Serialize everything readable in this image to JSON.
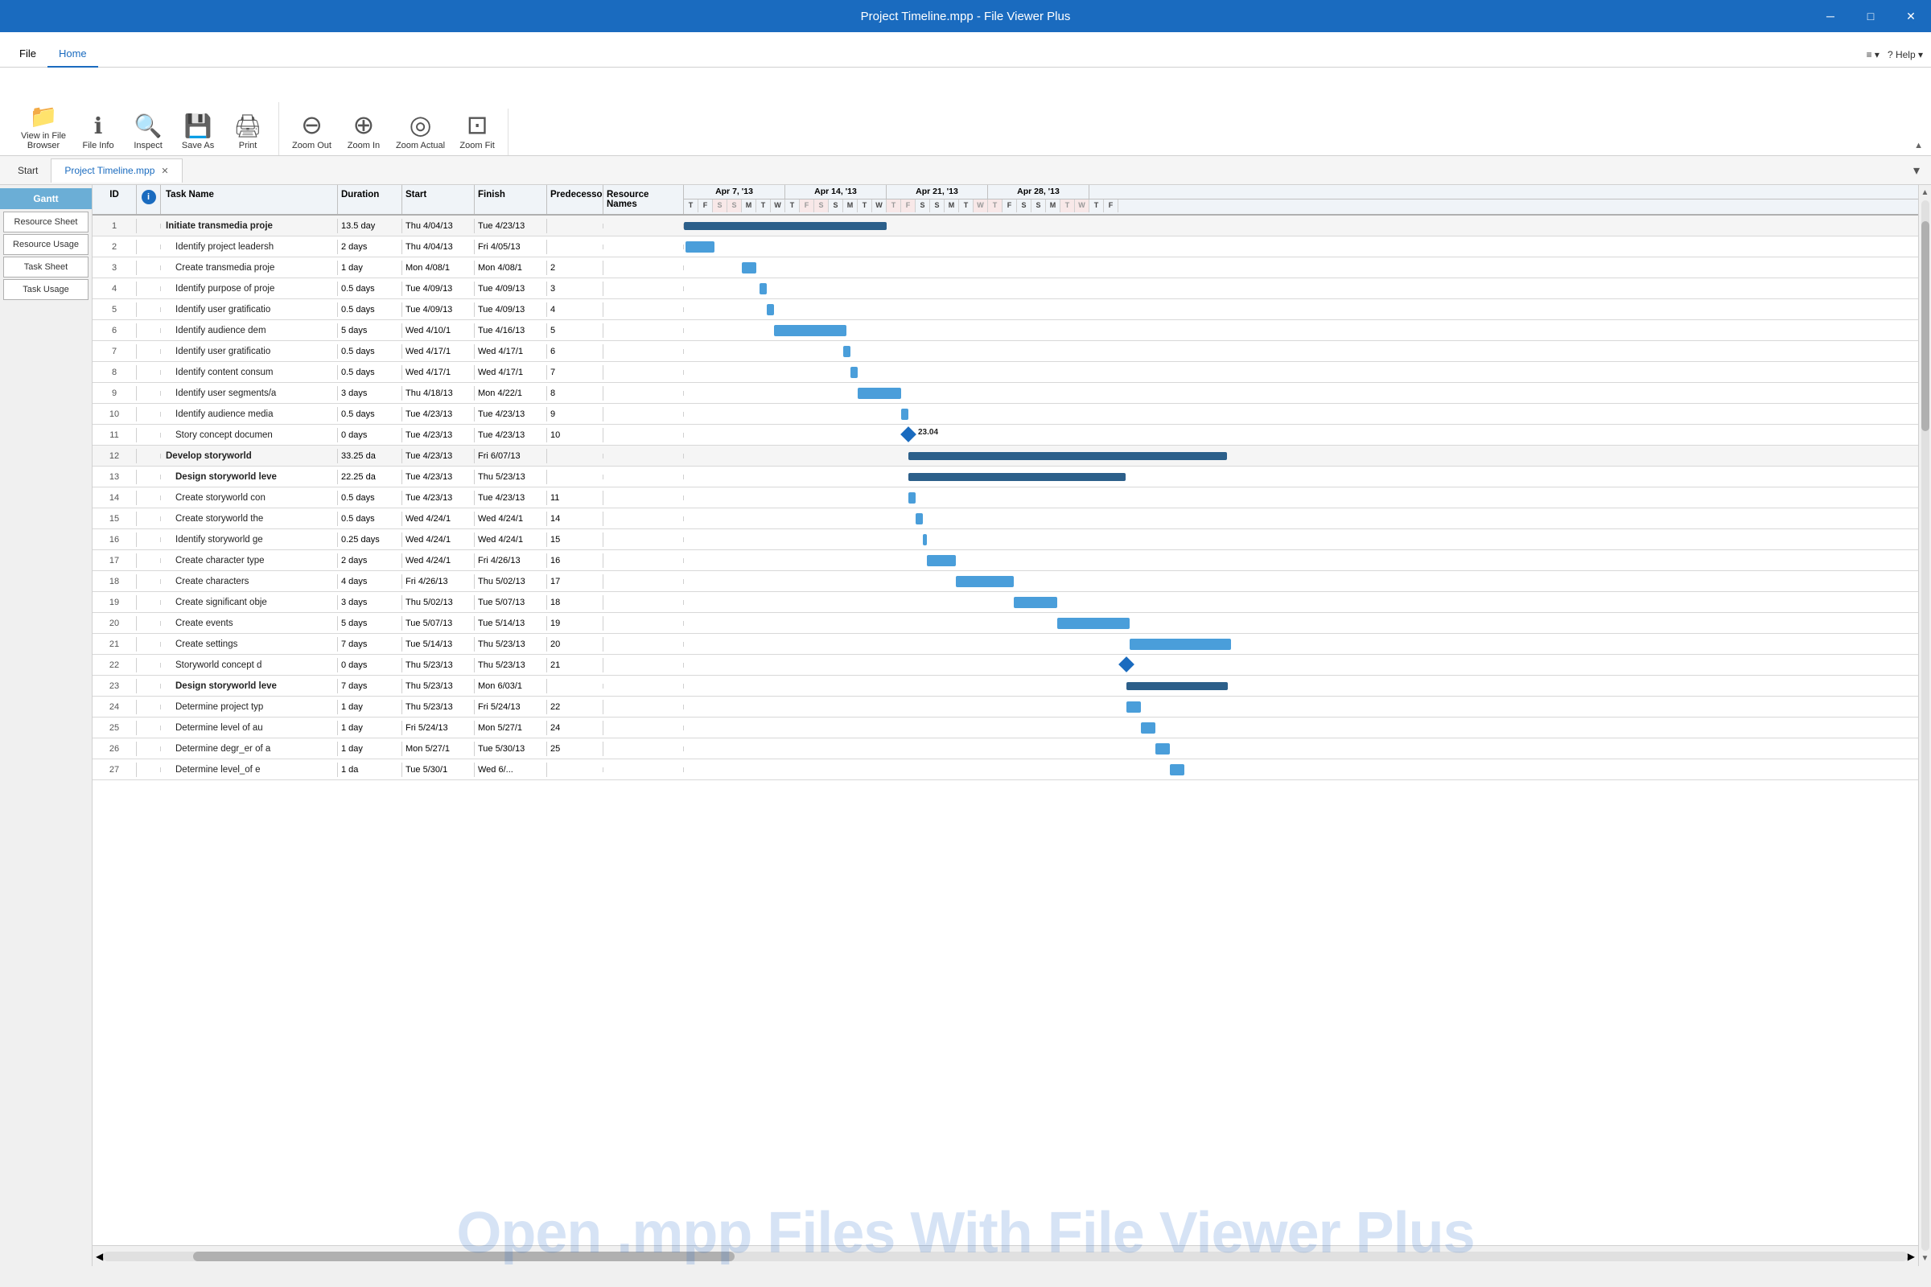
{
  "titleBar": {
    "title": "Project Timeline.mpp - File Viewer Plus",
    "minBtn": "─",
    "maxBtn": "□",
    "closeBtn": "✕"
  },
  "menuBar": {
    "items": [
      "File",
      "Home"
    ],
    "activeItem": "Home",
    "rightItems": [
      "≡ ▾",
      "? Help ▾"
    ]
  },
  "ribbon": {
    "buttons": [
      {
        "icon": "📁",
        "label": "View in File\nBrowser",
        "name": "view-in-file-browser"
      },
      {
        "icon": "ℹ",
        "label": "File Info",
        "name": "file-info"
      },
      {
        "icon": "🔍",
        "label": "Inspect",
        "name": "inspect"
      },
      {
        "icon": "💾",
        "label": "Save As",
        "name": "save-as"
      },
      {
        "icon": "🖨",
        "label": "Print",
        "name": "print"
      },
      {
        "icon": "⊖",
        "label": "Zoom Out",
        "name": "zoom-out"
      },
      {
        "icon": "⊕",
        "label": "Zoom In",
        "name": "zoom-in"
      },
      {
        "icon": "◎",
        "label": "Zoom Actual",
        "name": "zoom-actual"
      },
      {
        "icon": "⊡",
        "label": "Zoom Fit",
        "name": "zoom-fit"
      }
    ]
  },
  "tabs": {
    "startLabel": "Start",
    "fileTab": "Project Timeline.mpp",
    "closeBtn": "✕"
  },
  "sidebar": {
    "ganttLabel": "Gantt",
    "buttons": [
      {
        "label": "Resource Sheet",
        "active": false,
        "name": "resource-sheet-btn"
      },
      {
        "label": "Resource Usage",
        "active": false,
        "name": "resource-usage-btn"
      },
      {
        "label": "Task Sheet",
        "active": false,
        "name": "task-sheet-btn"
      },
      {
        "label": "Task Usage",
        "active": false,
        "name": "task-usage-btn"
      }
    ]
  },
  "table": {
    "headers": {
      "id": "ID",
      "info": "ℹ",
      "taskName": "Task Name",
      "duration": "Duration",
      "start": "Start",
      "finish": "Finish",
      "predecessors": "Predecesso",
      "resourceNames": "Resource Names"
    },
    "rows": [
      {
        "id": "1",
        "indent": false,
        "bold": true,
        "task": "Initiate transmedia proje",
        "duration": "13.5 day",
        "start": "Thu 4/04/13",
        "finish": "Tue 4/23/13",
        "pred": "",
        "res": ""
      },
      {
        "id": "2",
        "indent": true,
        "bold": false,
        "task": "Identify project leadersh",
        "duration": "2 days",
        "start": "Thu 4/04/13",
        "finish": "Fri 4/05/13",
        "pred": "",
        "res": ""
      },
      {
        "id": "3",
        "indent": true,
        "bold": false,
        "task": "Create transmedia proje",
        "duration": "1 day",
        "start": "Mon 4/08/1",
        "finish": "Mon 4/08/1",
        "pred": "2",
        "res": ""
      },
      {
        "id": "4",
        "indent": true,
        "bold": false,
        "task": "Identify purpose of proje",
        "duration": "0.5 days",
        "start": "Tue 4/09/13",
        "finish": "Tue 4/09/13",
        "pred": "3",
        "res": ""
      },
      {
        "id": "5",
        "indent": true,
        "bold": false,
        "task": "Identify user gratificatio",
        "duration": "0.5 days",
        "start": "Tue 4/09/13",
        "finish": "Tue 4/09/13",
        "pred": "4",
        "res": ""
      },
      {
        "id": "6",
        "indent": true,
        "bold": false,
        "task": "Identify audience dem",
        "duration": "5 days",
        "start": "Wed 4/10/1",
        "finish": "Tue 4/16/13",
        "pred": "5",
        "res": ""
      },
      {
        "id": "7",
        "indent": true,
        "bold": false,
        "task": "Identify user gratificatio",
        "duration": "0.5 days",
        "start": "Wed 4/17/1",
        "finish": "Wed 4/17/1",
        "pred": "6",
        "res": ""
      },
      {
        "id": "8",
        "indent": true,
        "bold": false,
        "task": "Identify content consum",
        "duration": "0.5 days",
        "start": "Wed 4/17/1",
        "finish": "Wed 4/17/1",
        "pred": "7",
        "res": ""
      },
      {
        "id": "9",
        "indent": true,
        "bold": false,
        "task": "Identify user segments/a",
        "duration": "3 days",
        "start": "Thu 4/18/13",
        "finish": "Mon 4/22/1",
        "pred": "8",
        "res": ""
      },
      {
        "id": "10",
        "indent": true,
        "bold": false,
        "task": "Identify audience media",
        "duration": "0.5 days",
        "start": "Tue 4/23/13",
        "finish": "Tue 4/23/13",
        "pred": "9",
        "res": ""
      },
      {
        "id": "11",
        "indent": true,
        "bold": false,
        "task": "Story concept documen",
        "duration": "0 days",
        "start": "Tue 4/23/13",
        "finish": "Tue 4/23/13",
        "pred": "10",
        "res": ""
      },
      {
        "id": "12",
        "indent": false,
        "bold": true,
        "task": "Develop storyworld",
        "duration": "33.25 da",
        "start": "Tue 4/23/13",
        "finish": "Fri 6/07/13",
        "pred": "",
        "res": ""
      },
      {
        "id": "13",
        "indent": true,
        "bold": true,
        "task": "Design storyworld leve",
        "duration": "22.25 da",
        "start": "Tue 4/23/13",
        "finish": "Thu 5/23/13",
        "pred": "",
        "res": ""
      },
      {
        "id": "14",
        "indent": true,
        "bold": false,
        "task": "Create storyworld con",
        "duration": "0.5 days",
        "start": "Tue 4/23/13",
        "finish": "Tue 4/23/13",
        "pred": "11",
        "res": ""
      },
      {
        "id": "15",
        "indent": true,
        "bold": false,
        "task": "Create storyworld the",
        "duration": "0.5 days",
        "start": "Wed 4/24/1",
        "finish": "Wed 4/24/1",
        "pred": "14",
        "res": ""
      },
      {
        "id": "16",
        "indent": true,
        "bold": false,
        "task": "Identify storyworld ge",
        "duration": "0.25 days",
        "start": "Wed 4/24/1",
        "finish": "Wed 4/24/1",
        "pred": "15",
        "res": ""
      },
      {
        "id": "17",
        "indent": true,
        "bold": false,
        "task": "Create character type",
        "duration": "2 days",
        "start": "Wed 4/24/1",
        "finish": "Fri 4/26/13",
        "pred": "16",
        "res": ""
      },
      {
        "id": "18",
        "indent": true,
        "bold": false,
        "task": "Create characters",
        "duration": "4 days",
        "start": "Fri 4/26/13",
        "finish": "Thu 5/02/13",
        "pred": "17",
        "res": ""
      },
      {
        "id": "19",
        "indent": true,
        "bold": false,
        "task": "Create significant obje",
        "duration": "3 days",
        "start": "Thu 5/02/13",
        "finish": "Tue 5/07/13",
        "pred": "18",
        "res": ""
      },
      {
        "id": "20",
        "indent": true,
        "bold": false,
        "task": "Create events",
        "duration": "5 days",
        "start": "Tue 5/07/13",
        "finish": "Tue 5/14/13",
        "pred": "19",
        "res": ""
      },
      {
        "id": "21",
        "indent": true,
        "bold": false,
        "task": "Create settings",
        "duration": "7 days",
        "start": "Tue 5/14/13",
        "finish": "Thu 5/23/13",
        "pred": "20",
        "res": ""
      },
      {
        "id": "22",
        "indent": true,
        "bold": false,
        "task": "Storyworld concept d",
        "duration": "0 days",
        "start": "Thu 5/23/13",
        "finish": "Thu 5/23/13",
        "pred": "21",
        "res": ""
      },
      {
        "id": "23",
        "indent": true,
        "bold": true,
        "task": "Design storyworld leve",
        "duration": "7 days",
        "start": "Thu 5/23/13",
        "finish": "Mon 6/03/1",
        "pred": "",
        "res": ""
      },
      {
        "id": "24",
        "indent": true,
        "bold": false,
        "task": "Determine project typ",
        "duration": "1 day",
        "start": "Thu 5/23/13",
        "finish": "Fri 5/24/13",
        "pred": "22",
        "res": ""
      },
      {
        "id": "25",
        "indent": true,
        "bold": false,
        "task": "Determine level of au",
        "duration": "1 day",
        "start": "Fri 5/24/13",
        "finish": "Mon 5/27/1",
        "pred": "24",
        "res": ""
      },
      {
        "id": "26",
        "indent": true,
        "bold": false,
        "task": "Determine degr_er of a",
        "duration": "1 day",
        "start": "Mon 5/27/1",
        "finish": "Tue 5/30/13",
        "pred": "25",
        "res": ""
      },
      {
        "id": "27",
        "indent": true,
        "bold": false,
        "task": "Determine level_of e",
        "duration": "1 da",
        "start": "Tue 5/30/1",
        "finish": "Wed 6/...",
        "pred": "",
        "res": ""
      }
    ]
  },
  "gantt": {
    "weeks": [
      {
        "label": "Apr 7, '13",
        "days": 7
      },
      {
        "label": "Apr 14, '13",
        "days": 7
      },
      {
        "label": "Apr 21, '13",
        "days": 7
      },
      {
        "label": "Apr 28, '13",
        "days": 7
      }
    ],
    "dayLabels": [
      "T",
      "F",
      "S",
      "S",
      "M",
      "T",
      "W",
      "T",
      "F",
      "S",
      "S",
      "M",
      "T",
      "W",
      "T",
      "F",
      "S",
      "S",
      "M",
      "T",
      "W",
      "T",
      "F",
      "S",
      "S",
      "M",
      "T",
      "W",
      "T",
      "F"
    ],
    "weekendIndices": [
      2,
      3,
      8,
      9,
      14,
      15,
      20,
      21,
      26,
      27
    ],
    "milestoneLabel": "23.04"
  },
  "watermark": "Open .mpp Files With File Viewer Plus",
  "scrollbar": {
    "left": "◀",
    "right": "▶"
  }
}
